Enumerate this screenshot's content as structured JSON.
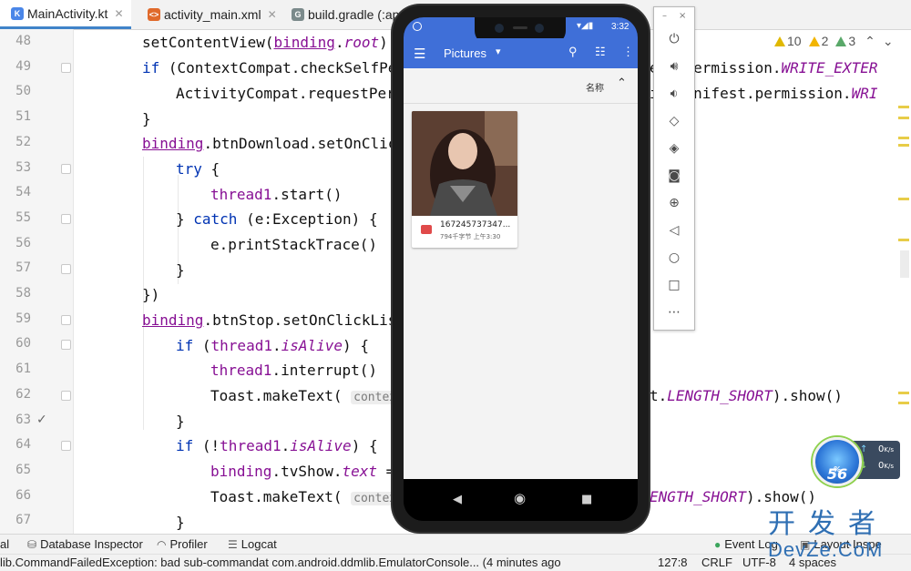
{
  "tabs": [
    {
      "label": "MainActivity.kt",
      "icon": "kotlin-file-icon",
      "active": true
    },
    {
      "label": "activity_main.xml",
      "icon": "xml-file-icon",
      "active": false
    },
    {
      "label": "build.gradle (:ap",
      "icon": "gradle-file-icon",
      "active": false
    }
  ],
  "inspections": {
    "warnings": "10",
    "weak_warnings": "2",
    "typos": "3"
  },
  "line_numbers": [
    "48",
    "49",
    "50",
    "51",
    "52",
    "53",
    "54",
    "55",
    "56",
    "57",
    "58",
    "59",
    "60",
    "61",
    "62",
    "63",
    "64",
    "65",
    "66",
    "67"
  ],
  "code": {
    "l48": {
      "binding": "binding",
      "root": "root"
    },
    "l49": {
      "text": "ContextCompat.checkSelfPer",
      "tail": "est.permission.",
      "perm": "WRITE_EXTER"
    },
    "l50": {
      "text": "ActivityCompat.requestPerm",
      "tail": "id.Manifest.permission.",
      "perm": "WRI"
    },
    "l52": {
      "text": ".btnDownload.setOnClick"
    },
    "l54": {
      "thread": "thread1",
      "call": ".start()"
    },
    "l55": {
      "type": "(e:Exception) {"
    },
    "l56": {
      "text": "e.printStackTrace()"
    },
    "l59": {
      "text": ".btnStop.setOnClickList"
    },
    "l60": {
      "alive": "isAlive"
    },
    "l61": {
      "call": ".interrupt()"
    },
    "l62": {
      "toast": "Toast.makeText(",
      "hint": "context:",
      "mid": "t.",
      "len": "LENGTH_SHORT",
      "end": ").show()"
    },
    "l64": {
      "alive": "isAlive"
    },
    "l65": {
      "text": ".tvShow.",
      "prop": "text",
      "eq": " ="
    },
    "l66": {
      "toast": "Toast.makeText(",
      "hint": "context:",
      "len": "ENGTH_SHORT",
      "end": ").show()"
    }
  },
  "keywords": {
    "if": "if",
    "try": "try",
    "catch": "catch"
  },
  "phone": {
    "time": "3:32",
    "app_title": "Pictures",
    "sort_label": "名称",
    "file_name": "167245737347...",
    "file_meta": "794千字节 上午3:30"
  },
  "toolwindows": {
    "db": "Database Inspector",
    "profiler": "Profiler",
    "logcat": "Logcat",
    "event_log": "Event Log",
    "layout_insp": "Layout Inspe",
    "left_stub": "al"
  },
  "status": {
    "message": "lib.CommandFailedException: bad sub-commandat com.android.ddmlib.EmulatorConsole... (4 minutes ago",
    "position": "127:8",
    "line_sep": "CRLF",
    "encoding": "UTF-8",
    "indent": "4 spaces"
  },
  "speed_widget": {
    "percent": "56",
    "up": "0",
    "down": "0",
    "unit": "K/s"
  },
  "watermark": {
    "cn": "开发者",
    "en": "DevZe.CoM"
  },
  "colors": {
    "accent_blue": "#3f6fd8",
    "keyword": "#0033b3",
    "property": "#871094"
  }
}
